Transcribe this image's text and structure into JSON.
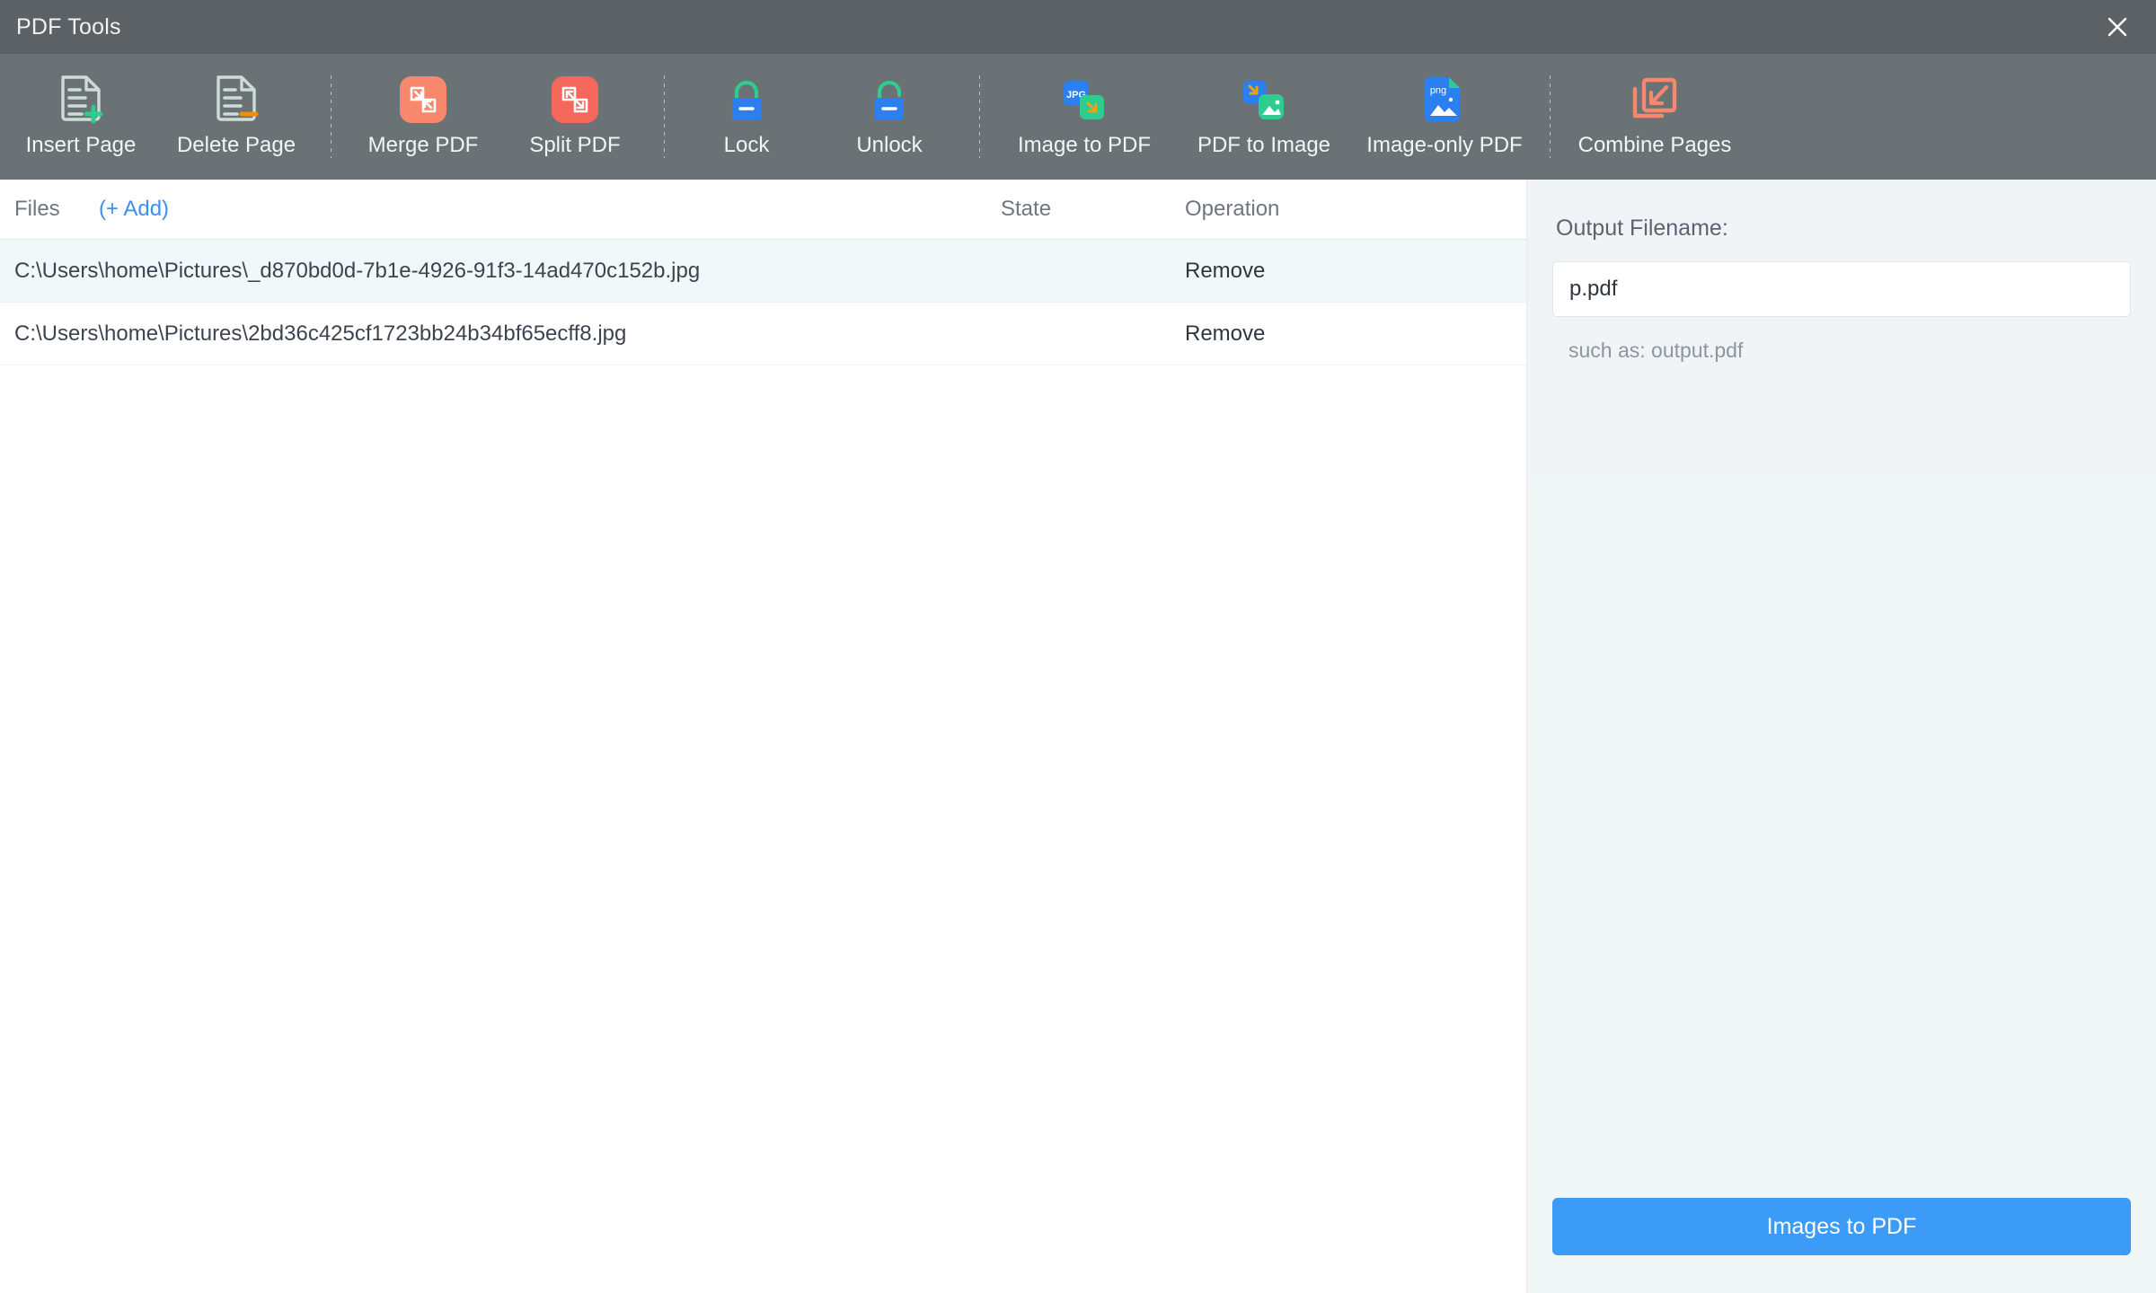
{
  "window": {
    "title": "PDF Tools",
    "close_icon": "close-icon"
  },
  "toolbar": {
    "items": [
      {
        "label": "Insert Page",
        "icon": "document-plus-icon"
      },
      {
        "label": "Delete Page",
        "icon": "document-minus-icon"
      },
      {
        "label": "Merge PDF",
        "icon": "merge-pdf-icon"
      },
      {
        "label": "Split PDF",
        "icon": "split-pdf-icon"
      },
      {
        "label": "Lock",
        "icon": "lock-closed-icon"
      },
      {
        "label": "Unlock",
        "icon": "lock-open-icon"
      },
      {
        "label": "Image to PDF",
        "icon": "jpg-to-pdf-icon"
      },
      {
        "label": "PDF to Image",
        "icon": "pdf-to-image-icon"
      },
      {
        "label": "Image-only PDF",
        "icon": "png-document-icon"
      },
      {
        "label": "Combine Pages",
        "icon": "combine-pages-icon"
      }
    ]
  },
  "file_list": {
    "columns": {
      "files": "Files",
      "add": "(+ Add)",
      "state": "State",
      "operation": "Operation"
    },
    "rows": [
      {
        "path": "C:\\Users\\home\\Pictures\\_d870bd0d-7b1e-4926-91f3-14ad470c152b.jpg",
        "state": "",
        "operation": "Remove"
      },
      {
        "path": "C:\\Users\\home\\Pictures\\2bd36c425cf1723bb24b34bf65ecff8.jpg",
        "state": "",
        "operation": "Remove"
      }
    ]
  },
  "panel": {
    "output_label": "Output Filename:",
    "output_value": "p.pdf",
    "output_placeholder": "output.pdf",
    "hint": "such as: output.pdf",
    "action_label": "Images to PDF"
  },
  "colors": {
    "titlebar": "#5c6165",
    "toolbar": "#6a7275",
    "accent_blue": "#3b9bf7",
    "link_blue": "#3b8ff5",
    "salmon_light": "#f8886c",
    "salmon_dark": "#f4685c",
    "green": "#2ecc8f",
    "orange": "#f09000",
    "icon_gray": "#cfdcd6",
    "row_alt": "#f1f8fa"
  }
}
